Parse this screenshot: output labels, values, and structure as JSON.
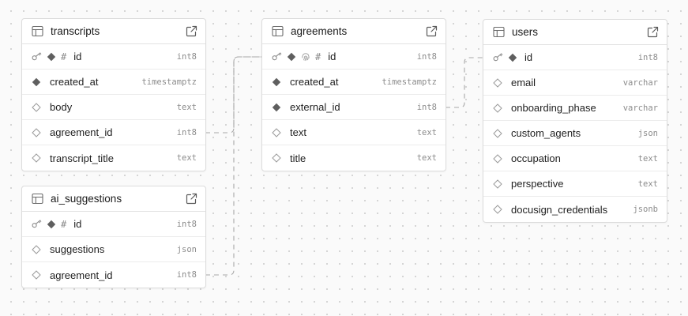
{
  "tables": [
    {
      "name": "transcripts",
      "columns": [
        {
          "name": "id",
          "type": "int8",
          "icons": [
            "key-icon",
            "diamond-filled-icon",
            "hash-icon"
          ]
        },
        {
          "name": "created_at",
          "type": "timestamptz",
          "icons": [
            "diamond-filled-icon"
          ]
        },
        {
          "name": "body",
          "type": "text",
          "icons": [
            "diamond-outline-icon"
          ]
        },
        {
          "name": "agreement_id",
          "type": "int8",
          "icons": [
            "diamond-outline-icon"
          ]
        },
        {
          "name": "transcript_title",
          "type": "text",
          "icons": [
            "diamond-outline-icon"
          ]
        }
      ]
    },
    {
      "name": "ai_suggestions",
      "columns": [
        {
          "name": "id",
          "type": "int8",
          "icons": [
            "key-icon",
            "diamond-filled-icon",
            "hash-icon"
          ]
        },
        {
          "name": "suggestions",
          "type": "json",
          "icons": [
            "diamond-outline-icon"
          ]
        },
        {
          "name": "agreement_id",
          "type": "int8",
          "icons": [
            "diamond-outline-icon"
          ]
        }
      ]
    },
    {
      "name": "agreements",
      "columns": [
        {
          "name": "id",
          "type": "int8",
          "icons": [
            "key-icon",
            "diamond-filled-icon",
            "fingerprint-icon",
            "hash-icon"
          ]
        },
        {
          "name": "created_at",
          "type": "timestamptz",
          "icons": [
            "diamond-filled-icon"
          ]
        },
        {
          "name": "external_id",
          "type": "int8",
          "icons": [
            "diamond-filled-icon"
          ]
        },
        {
          "name": "text",
          "type": "text",
          "icons": [
            "diamond-outline-icon"
          ]
        },
        {
          "name": "title",
          "type": "text",
          "icons": [
            "diamond-outline-icon"
          ]
        }
      ]
    },
    {
      "name": "users",
      "columns": [
        {
          "name": "id",
          "type": "int8",
          "icons": [
            "key-icon",
            "diamond-filled-icon"
          ]
        },
        {
          "name": "email",
          "type": "varchar",
          "icons": [
            "diamond-outline-icon"
          ]
        },
        {
          "name": "onboarding_phase",
          "type": "varchar",
          "icons": [
            "diamond-outline-icon"
          ]
        },
        {
          "name": "custom_agents",
          "type": "json",
          "icons": [
            "diamond-outline-icon"
          ]
        },
        {
          "name": "occupation",
          "type": "text",
          "icons": [
            "diamond-outline-icon"
          ]
        },
        {
          "name": "perspective",
          "type": "text",
          "icons": [
            "diamond-outline-icon"
          ]
        },
        {
          "name": "docusign_credentials",
          "type": "jsonb",
          "icons": [
            "diamond-outline-icon"
          ]
        }
      ]
    }
  ],
  "relationships": [
    {
      "from": "transcripts.agreement_id",
      "to": "agreements.id"
    },
    {
      "from": "ai_suggestions.agreement_id",
      "to": "agreements.id"
    },
    {
      "from": "agreements.external_id",
      "to": "users.id"
    }
  ],
  "colors": {
    "canvas": "#fafafa",
    "dot": "#cfcfcf",
    "border": "#dcdcdc",
    "link": "#a8a8a8",
    "icon": "#5f5f5f"
  }
}
